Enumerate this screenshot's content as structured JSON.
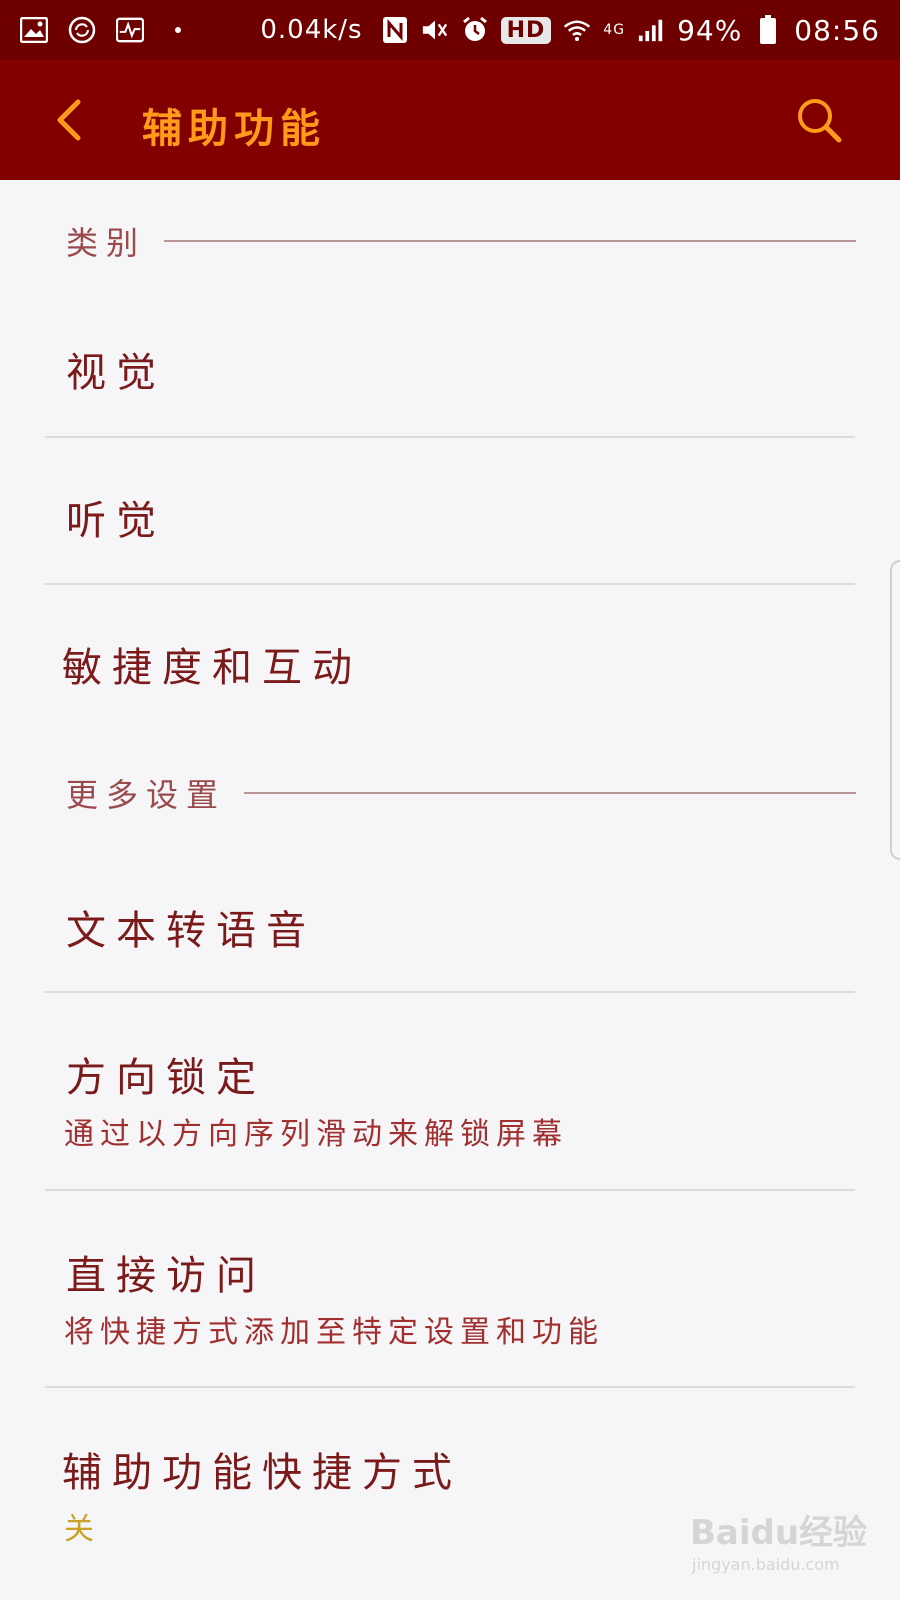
{
  "status_bar": {
    "icons_left": [
      "image-icon",
      "sync-icon",
      "activity-icon",
      "dot-icon"
    ],
    "net_speed": "0.04k/s",
    "hd_badge": "HD",
    "network_type": "4G",
    "battery": "94%",
    "time": "08:56"
  },
  "app_bar": {
    "title": "辅助功能",
    "back_icon": "chevron-left-icon",
    "search_icon": "search-icon",
    "accent_color": "#ff9a1a",
    "background_color": "#830000"
  },
  "sections": {
    "category": {
      "title": "类别"
    },
    "more": {
      "title": "更多设置"
    }
  },
  "items": {
    "vision": {
      "title": "视觉"
    },
    "hearing": {
      "title": "听觉"
    },
    "dexterity": {
      "title": "敏捷度和互动"
    },
    "tts": {
      "title": "文本转语音"
    },
    "direction_lock": {
      "title": "方向锁定",
      "subtitle": "通过以方向序列滑动来解锁屏幕"
    },
    "direct_access": {
      "title": "直接访问",
      "subtitle": "将快捷方式添加至特定设置和功能"
    },
    "shortcut": {
      "title": "辅助功能快捷方式",
      "subtitle": "关"
    }
  },
  "watermark": {
    "logo": "Baidu经验",
    "url": "jingyan.baidu.com"
  }
}
